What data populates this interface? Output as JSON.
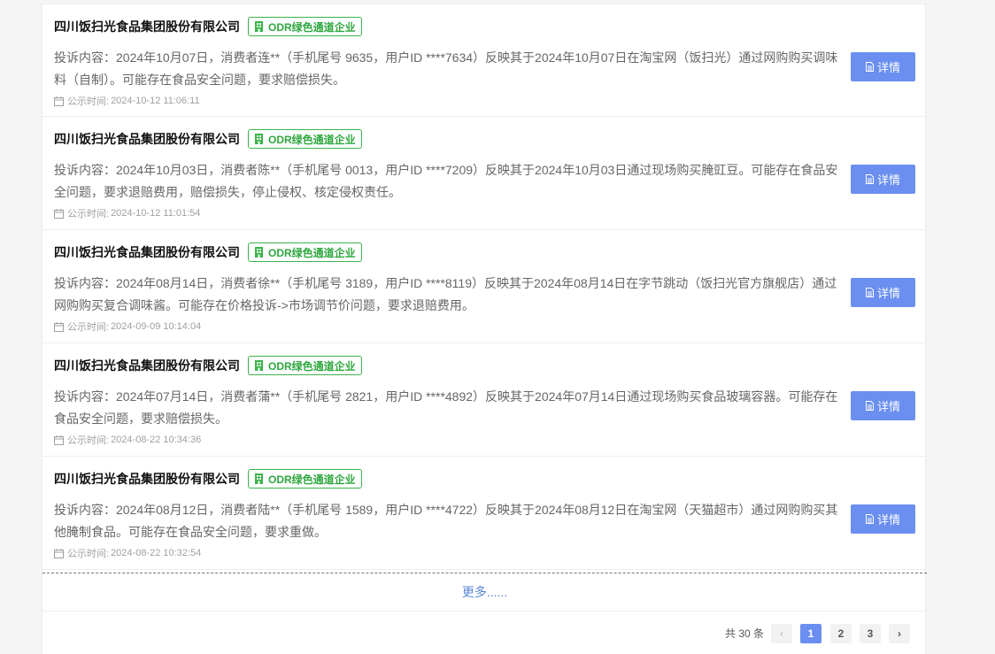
{
  "list": {
    "items": [
      {
        "company": "四川饭扫光食品集团股份有限公司",
        "badge": "ODR绿色通道企业",
        "content": "投诉内容：2024年10月07日，消费者连**（手机尾号 9635，用户ID ****7634）反映其于2024年10月07日在淘宝网（饭扫光）通过网购购买调味料（自制）。可能存在食品安全问题，要求赔偿损失。",
        "time_label": "公示时间:",
        "time": "2024-10-12 11:06:11",
        "button": "详情"
      },
      {
        "company": "四川饭扫光食品集团股份有限公司",
        "badge": "ODR绿色通道企业",
        "content": "投诉内容：2024年10月03日，消费者陈**（手机尾号 0013，用户ID ****7209）反映其于2024年10月03日通过现场购买腌豇豆。可能存在食品安全问题，要求退赔费用，赔偿损失，停止侵权、核定侵权责任。",
        "time_label": "公示时间:",
        "time": "2024-10-12 11:01:54",
        "button": "详情"
      },
      {
        "company": "四川饭扫光食品集团股份有限公司",
        "badge": "ODR绿色通道企业",
        "content": "投诉内容：2024年08月14日，消费者徐**（手机尾号 3189，用户ID ****8119）反映其于2024年08月14日在字节跳动（饭扫光官方旗舰店）通过网购购买复合调味酱。可能存在价格投诉->市场调节价问题，要求退赔费用。",
        "time_label": "公示时间:",
        "time": "2024-09-09 10:14:04",
        "button": "详情"
      },
      {
        "company": "四川饭扫光食品集团股份有限公司",
        "badge": "ODR绿色通道企业",
        "content": "投诉内容：2024年07月14日，消费者蒲**（手机尾号 2821，用户ID ****4892）反映其于2024年07月14日通过现场购买食品玻璃容器。可能存在食品安全问题，要求赔偿损失。",
        "time_label": "公示时间:",
        "time": "2024-08-22 10:34:36",
        "button": "详情"
      },
      {
        "company": "四川饭扫光食品集团股份有限公司",
        "badge": "ODR绿色通道企业",
        "content": "投诉内容：2024年08月12日，消费者陆**（手机尾号 1589，用户ID ****4722）反映其于2024年08月12日在淘宝网（天猫超市）通过网购购买其他腌制食品。可能存在食品安全问题，要求重做。",
        "time_label": "公示时间:",
        "time": "2024-08-22 10:32:54",
        "button": "详情"
      }
    ],
    "more": "更多......"
  },
  "pagination": {
    "total": "共 30 条",
    "prev": "‹",
    "next": "›",
    "pages": [
      "1",
      "2",
      "3"
    ],
    "current": "1"
  },
  "colors": {
    "accent": "#6b8ff0",
    "badge_green": "#3cb44b",
    "link": "#5a86d6"
  },
  "icons": {
    "badge": "building-icon",
    "time": "calendar-icon",
    "button": "document-icon"
  }
}
